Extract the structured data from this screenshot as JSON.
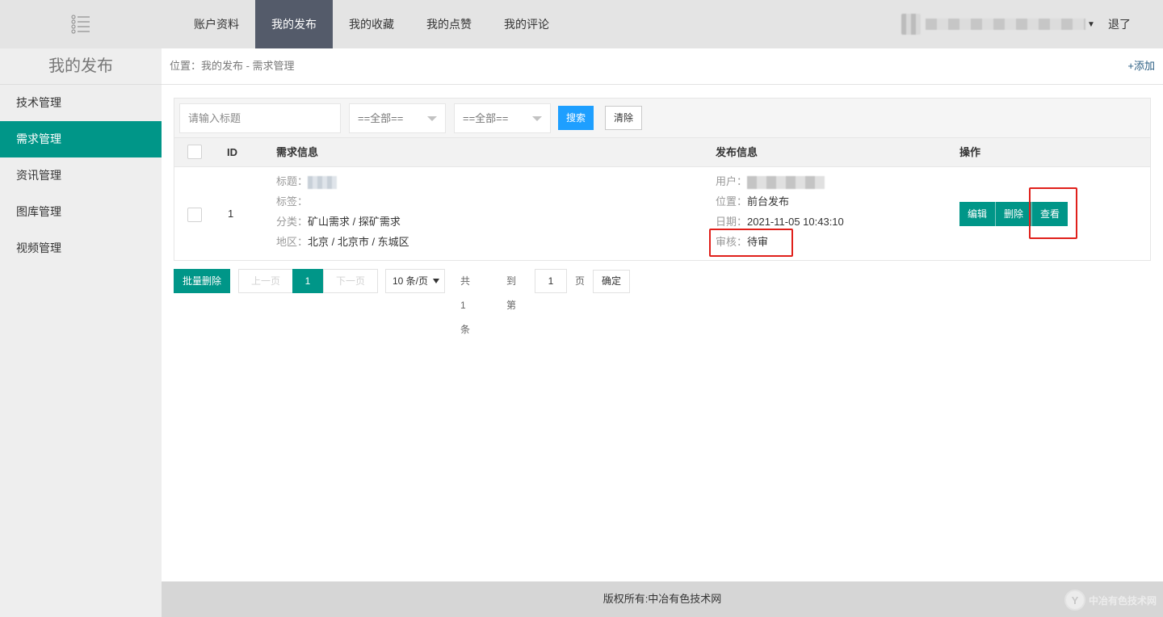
{
  "header": {
    "nav": [
      {
        "label": "账户资料",
        "active": false
      },
      {
        "label": "我的发布",
        "active": true
      },
      {
        "label": "我的收藏",
        "active": false
      },
      {
        "label": "我的点赞",
        "active": false
      },
      {
        "label": "我的评论",
        "active": false
      }
    ],
    "logout": "退了"
  },
  "sidebar": {
    "title": "我的发布",
    "items": [
      {
        "label": "技术管理",
        "active": false
      },
      {
        "label": "需求管理",
        "active": true
      },
      {
        "label": "资讯管理",
        "active": false
      },
      {
        "label": "图库管理",
        "active": false
      },
      {
        "label": "视频管理",
        "active": false
      }
    ]
  },
  "breadcrumb": "位置：我的发布 - 需求管理",
  "add_link": "+添加",
  "filters": {
    "search_placeholder": "请输入标题",
    "select1": "==全部==",
    "select2": "==全部==",
    "search_btn": "搜索",
    "clear_btn": "清除"
  },
  "table": {
    "headers": {
      "id": "ID",
      "demand_info": "需求信息",
      "publish_info": "发布信息",
      "actions": "操作"
    },
    "rows": [
      {
        "id": "1",
        "title_label": "标题：",
        "tags_label": "标签：",
        "category_label": "分类：",
        "category": "矿山需求 / 探矿需求",
        "region_label": "地区：",
        "region": "北京 / 北京市 / 东城区",
        "user_label": "用户：",
        "location_label": "位置：",
        "location": "前台发布",
        "date_label": "日期：",
        "date": "2021-11-05 10:43:10",
        "review_label": "审核：",
        "review": "待审",
        "actions": {
          "edit": "编辑",
          "delete": "删除",
          "view": "查看"
        }
      }
    ]
  },
  "pager": {
    "batch_delete": "批量删除",
    "prev": "上一页",
    "current": "1",
    "next": "下一页",
    "page_size": "10 条/页",
    "total": "共 1 条",
    "goto_label": "到第",
    "goto_value": "1",
    "page_unit": "页",
    "confirm": "确定"
  },
  "footer": {
    "copyright": "版权所有:中冶有色技术网",
    "watermark": "中冶有色技术网"
  },
  "colors": {
    "primary": "#009688",
    "nav_active": "#545b6a",
    "search_blue": "#1e9fff",
    "highlight_red": "#e0201b"
  }
}
